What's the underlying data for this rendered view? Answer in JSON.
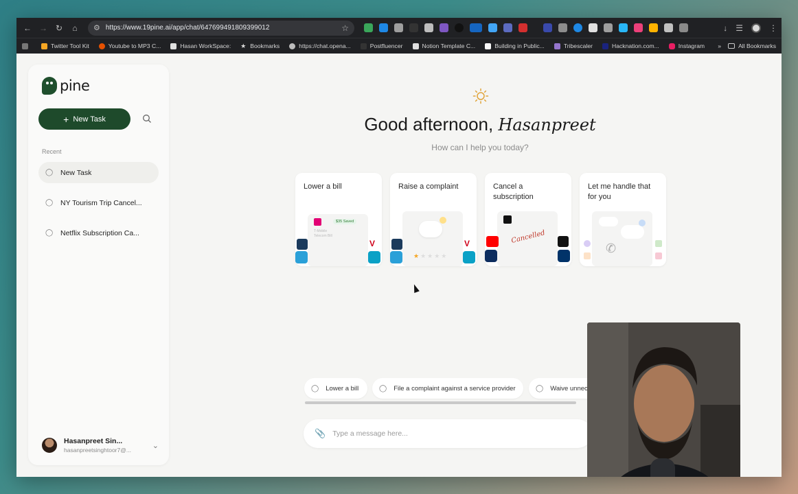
{
  "browser": {
    "url": "https://www.19pine.ai/app/chat/647699491809399012",
    "bookmarks": [
      "Twitter Tool Kit",
      "Youtube to MP3 C...",
      "Hasan WorkSpace:",
      "Bookmarks",
      "https://chat.opena...",
      "Postfluencer",
      "Notion Template C...",
      "Building in Public...",
      "Tribescaler",
      "Hacknation.com...",
      "Instagram"
    ],
    "all_bookmarks": "All Bookmarks",
    "more_bookmarks": "»"
  },
  "sidebar": {
    "logo": "pine",
    "new_task": "New Task",
    "recent_label": "Recent",
    "items": [
      {
        "label": "New Task"
      },
      {
        "label": "NY Tourism Trip Cancel..."
      },
      {
        "label": "Netflix Subscription Ca..."
      }
    ],
    "user": {
      "name": "Hasanpreet Sin...",
      "email": "hasanpreetsinghtoor7@..."
    }
  },
  "main": {
    "greeting": "Good afternoon,",
    "greeting_name": "Hasanpreet",
    "subtitle": "How can I help you today?",
    "cards": [
      {
        "title": "Lower a bill",
        "art_badge": "$35 Saved",
        "art_line1": "T-Mobile",
        "art_line2": "Telecom Bill"
      },
      {
        "title": "Raise a complaint"
      },
      {
        "title": "Cancel a subscription",
        "art_stamp": "Cancelled"
      },
      {
        "title": "Let me handle that for you"
      }
    ],
    "suggestions": [
      "Lower a bill",
      "File a complaint against a service provider",
      "Waive unnec"
    ],
    "composer_placeholder": "Type a message here..."
  },
  "colors": {
    "brand": "#1e4a2b",
    "sun": "#e0a43a",
    "accent_stamp": "#c0392b"
  },
  "icons": [
    "back-icon",
    "forward-icon",
    "reload-icon",
    "home-icon",
    "bookmark-star-icon",
    "sun-icon",
    "search-icon",
    "chat-bubble-icon",
    "paperclip-icon",
    "chevron-down-icon",
    "plus-icon"
  ]
}
